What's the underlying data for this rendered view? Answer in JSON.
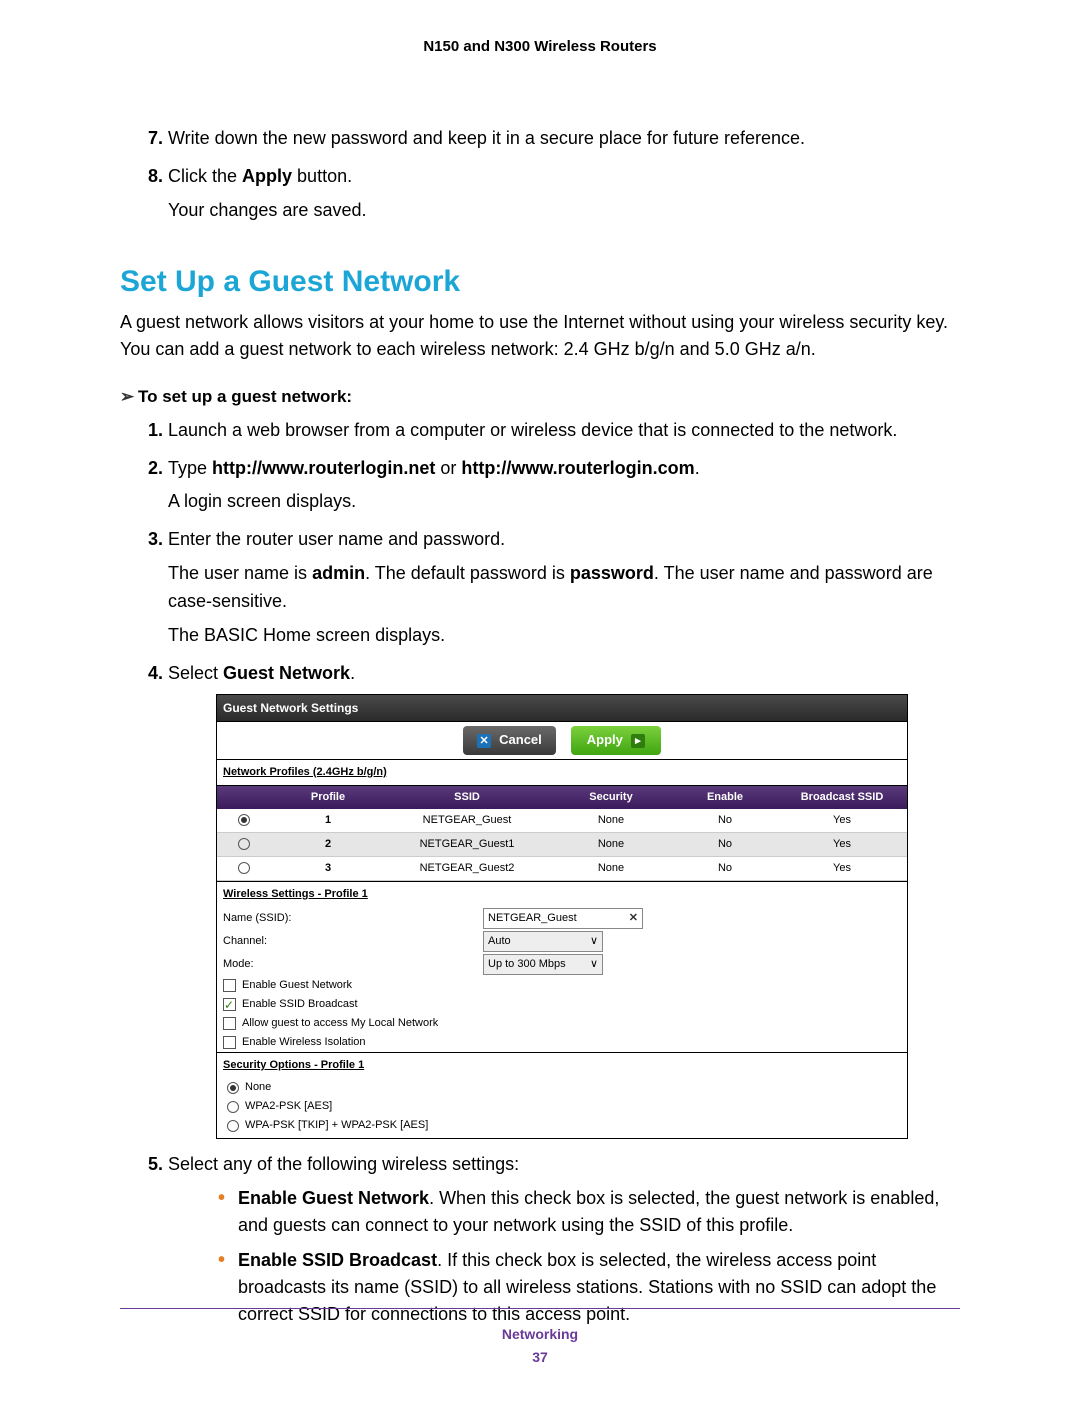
{
  "header": "N150 and N300 Wireless Routers",
  "steps_a": [
    {
      "n": "7.",
      "text": "Write down the new password and keep it in a secure place for future reference."
    },
    {
      "n": "8.",
      "pre": "Click the ",
      "bold": "Apply",
      "post": " button.",
      "sub": "Your changes are saved."
    }
  ],
  "section_title": "Set Up a Guest Network",
  "section_intro": "A guest network allows visitors at your home to use the Internet without using your wireless security key. You can add a guest network to each wireless network: 2.4 GHz b/g/n and 5.0 GHz a/n.",
  "task_title": "To set up a guest network:",
  "steps_b1_text": "Launch a web browser from a computer or wireless device that is connected to the network.",
  "steps_b2_pre": "Type ",
  "steps_b2_bold": "http://www.routerlogin.net",
  "steps_b2_mid": " or ",
  "steps_b2_bold2": "http://www.routerlogin.com",
  "steps_b2_post": ".",
  "steps_b2_sub": "A login screen displays.",
  "steps_b3_text": "Enter the router user name and password.",
  "steps_b3_sub1_parts": [
    "The user name is ",
    "admin",
    ". The default password is ",
    "password",
    ". The user name and password are case-sensitive."
  ],
  "steps_b3_sub2": "The BASIC Home screen displays.",
  "steps_b4_pre": "Select ",
  "steps_b4_bold": "Guest Network",
  "steps_b4_post": ".",
  "screenshot": {
    "title": "Guest Network Settings",
    "cancel": "Cancel",
    "apply": "Apply",
    "profiles_title": "Network Profiles (2.4GHz b/g/n)",
    "cols": [
      "",
      "Profile",
      "SSID",
      "Security",
      "Enable",
      "Broadcast SSID"
    ],
    "rows": [
      {
        "sel": true,
        "profile": "1",
        "ssid": "NETGEAR_Guest",
        "sec": "None",
        "en": "No",
        "bc": "Yes"
      },
      {
        "sel": false,
        "profile": "2",
        "ssid": "NETGEAR_Guest1",
        "sec": "None",
        "en": "No",
        "bc": "Yes"
      },
      {
        "sel": false,
        "profile": "3",
        "ssid": "NETGEAR_Guest2",
        "sec": "None",
        "en": "No",
        "bc": "Yes"
      }
    ],
    "ws_title": "Wireless Settings - Profile 1",
    "name_label": "Name (SSID):",
    "name_value": "NETGEAR_Guest",
    "channel_label": "Channel:",
    "channel_value": "Auto",
    "mode_label": "Mode:",
    "mode_value": "Up to 300 Mbps",
    "checks": [
      {
        "on": false,
        "label": "Enable Guest Network"
      },
      {
        "on": true,
        "label": "Enable SSID Broadcast"
      },
      {
        "on": false,
        "label": "Allow guest to access My Local Network"
      },
      {
        "on": false,
        "label": "Enable Wireless Isolation"
      }
    ],
    "sec_title": "Security Options - Profile 1",
    "sec_opts": [
      {
        "on": true,
        "label": "None"
      },
      {
        "on": false,
        "label": "WPA2-PSK [AES]"
      },
      {
        "on": false,
        "label": "WPA-PSK [TKIP] + WPA2-PSK [AES]"
      }
    ]
  },
  "steps_b5_text": "Select any of the following wireless settings:",
  "bullets": [
    {
      "bold": "Enable Guest Network",
      "rest": ". When this check box is selected, the guest network is enabled, and guests can connect to your network using the SSID of this profile."
    },
    {
      "bold": "Enable SSID Broadcast",
      "rest": ". If this check box is selected, the wireless access point broadcasts its name (SSID) to all wireless stations. Stations with no SSID can adopt the correct SSID for connections to this access point."
    }
  ],
  "footer_section": "Networking",
  "footer_page": "37"
}
